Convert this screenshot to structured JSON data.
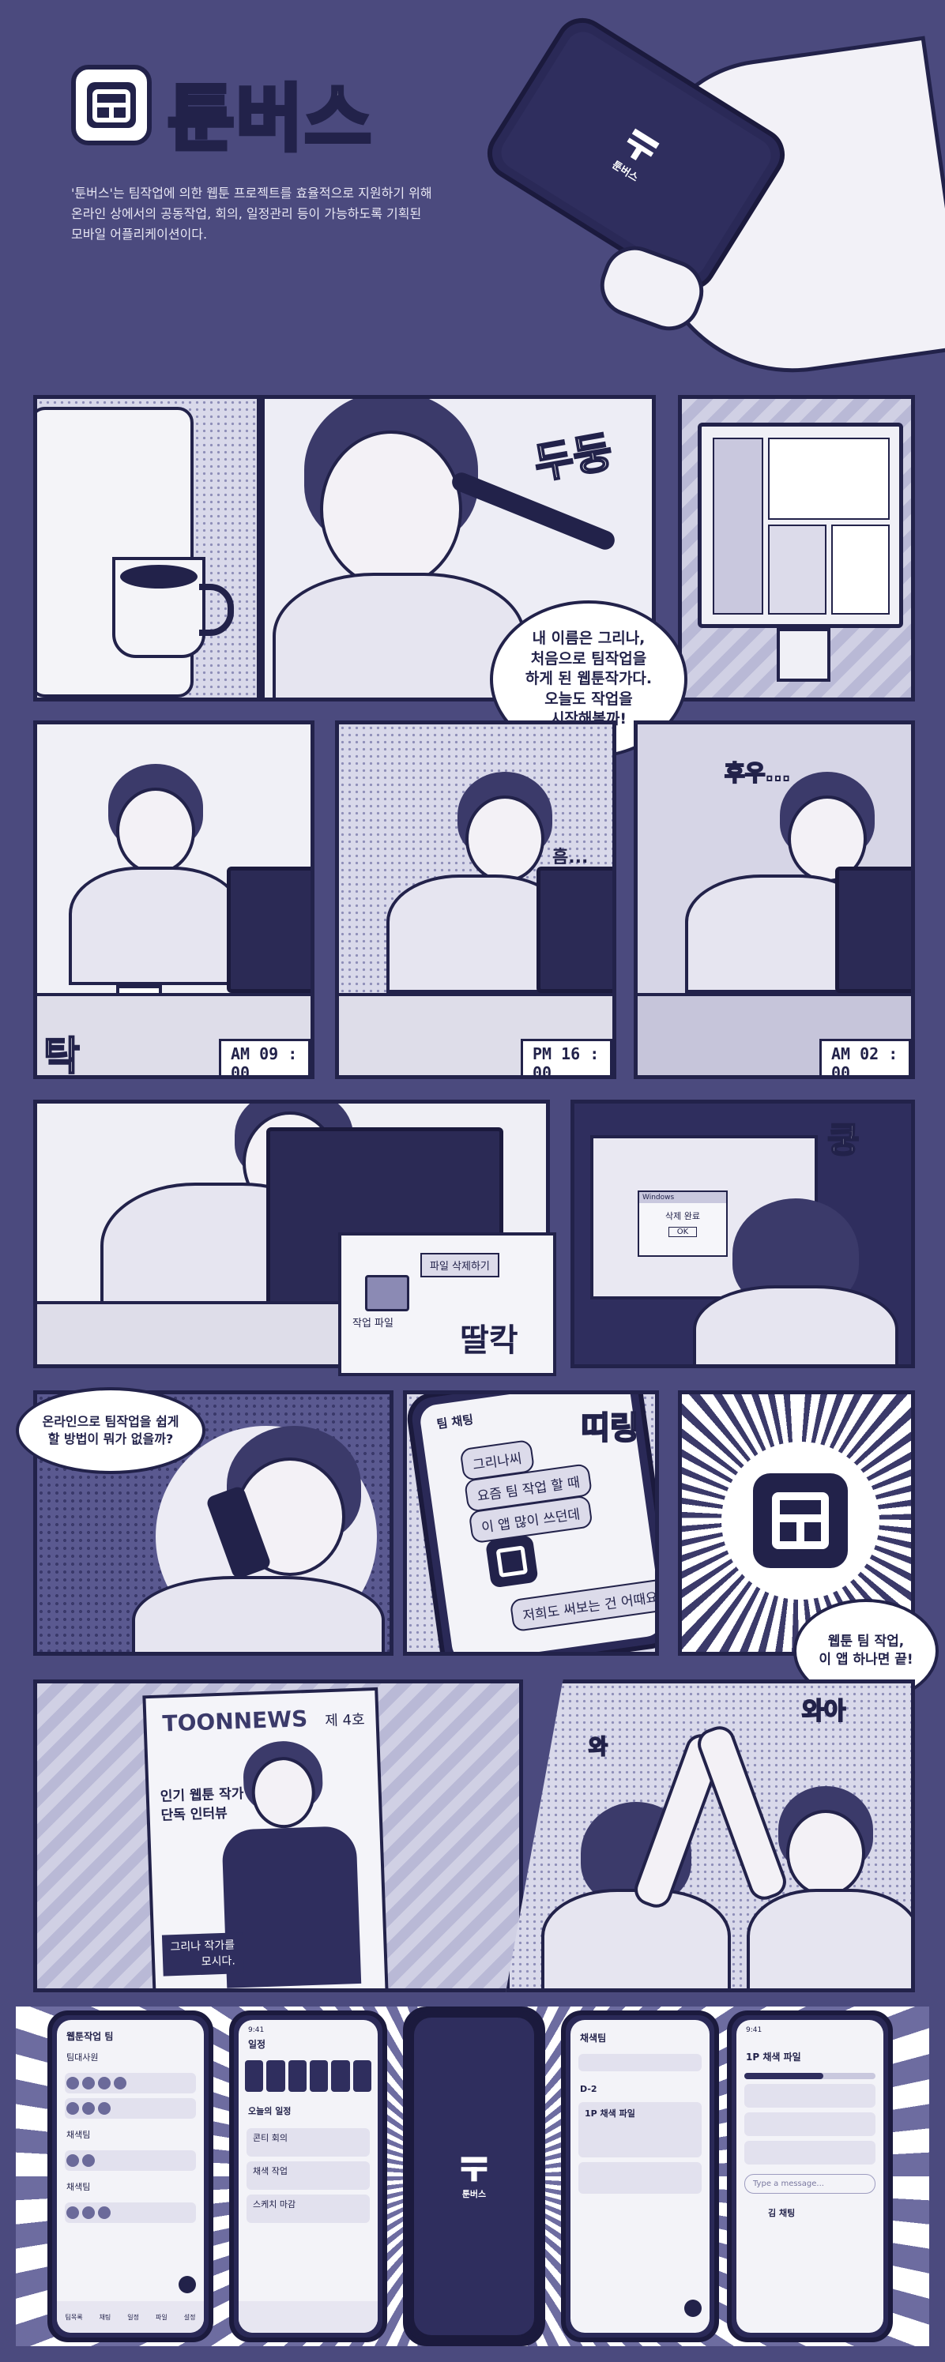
{
  "brand": {
    "name": "툰버스",
    "description_line1": "'툰버스'는 팀작업에 의한 웹툰 프로젝트를 효율적으로 지원하기 위해",
    "description_line2": "온라인 상에서의 공동작업, 회의, 일정관리 등이 가능하도록 기획된",
    "description_line3": "모바일 어플리케이션이다.",
    "hero_phone_label": "툰버스"
  },
  "row1": {
    "sfx_scribble": "두둥",
    "bubble": "내 이름은 그리나,\n처음으로 팀작업을\n하게 된 웹툰작가다.\n오늘도 작업을\n시작해볼까!"
  },
  "row2": {
    "sfx_tak": "탁",
    "time1": "AM 09 : 00",
    "sfx_sigh": "흠...",
    "time2": "PM 16 : 00",
    "sfx_huh": "후우...",
    "time3": "AM 02 : 00"
  },
  "row3": {
    "menu_delete": "파일 삭제하기",
    "file_label": "작업 파일",
    "sfx_click": "딸칵",
    "dialog_title": "Windows",
    "dialog_message": "삭제 완료",
    "dialog_ok": "OK",
    "sfx_thud": "쿵"
  },
  "row4": {
    "thought_bubble": "온라인으로 팀작업을 쉽게\n할 방법이 뭐가 없을까?",
    "chat_header": "팀 채팅",
    "chat1": "그리나씨",
    "chat2": "요즘 팀 작업 할 때",
    "chat3": "이 앱 많이 쓰던데",
    "chat4": "저희도 써보는 건 어때요",
    "sfx_ding": "띠링",
    "bubble": "웹툰 팀 작업,\n이 앱 하나면 끝!"
  },
  "row5": {
    "magazine_title": "TOONNEWS",
    "magazine_issue": "제 4호",
    "magazine_headline1": "인기 웹툰 작가",
    "magazine_headline2": "단독 인터뷰",
    "magazine_caption1": "그리나 작가를",
    "magazine_caption2": "모시다.",
    "sfx_wa1": "와아",
    "sfx_wa2": "와"
  },
  "app_screens": {
    "s1_title": "웹툰작업 팀",
    "s1_sections": [
      "팀대사원",
      "채색팀",
      "채색팀"
    ],
    "s1_nav": [
      "팀목록",
      "채팅",
      "일정",
      "파일",
      "설정"
    ],
    "s2_time": "9:41",
    "s2_title": "일정",
    "s2_subtitle": "오늘의 일정",
    "s2_items": [
      "콘티 회의",
      "채색 작업",
      "스케치 마감"
    ],
    "s3_brand": "툰버스",
    "s4_title": "채색팀",
    "s4_items": [
      "D-2",
      "1P 채색 파일"
    ],
    "s5_time": "9:41",
    "s5_title": "1P 채색 파일",
    "s5_placeholder": "Type a message...",
    "s5_commenter": "김 채팅"
  },
  "colors": {
    "background": "#4b4a7e",
    "ink": "#22224a",
    "paper": "#ececf4"
  }
}
